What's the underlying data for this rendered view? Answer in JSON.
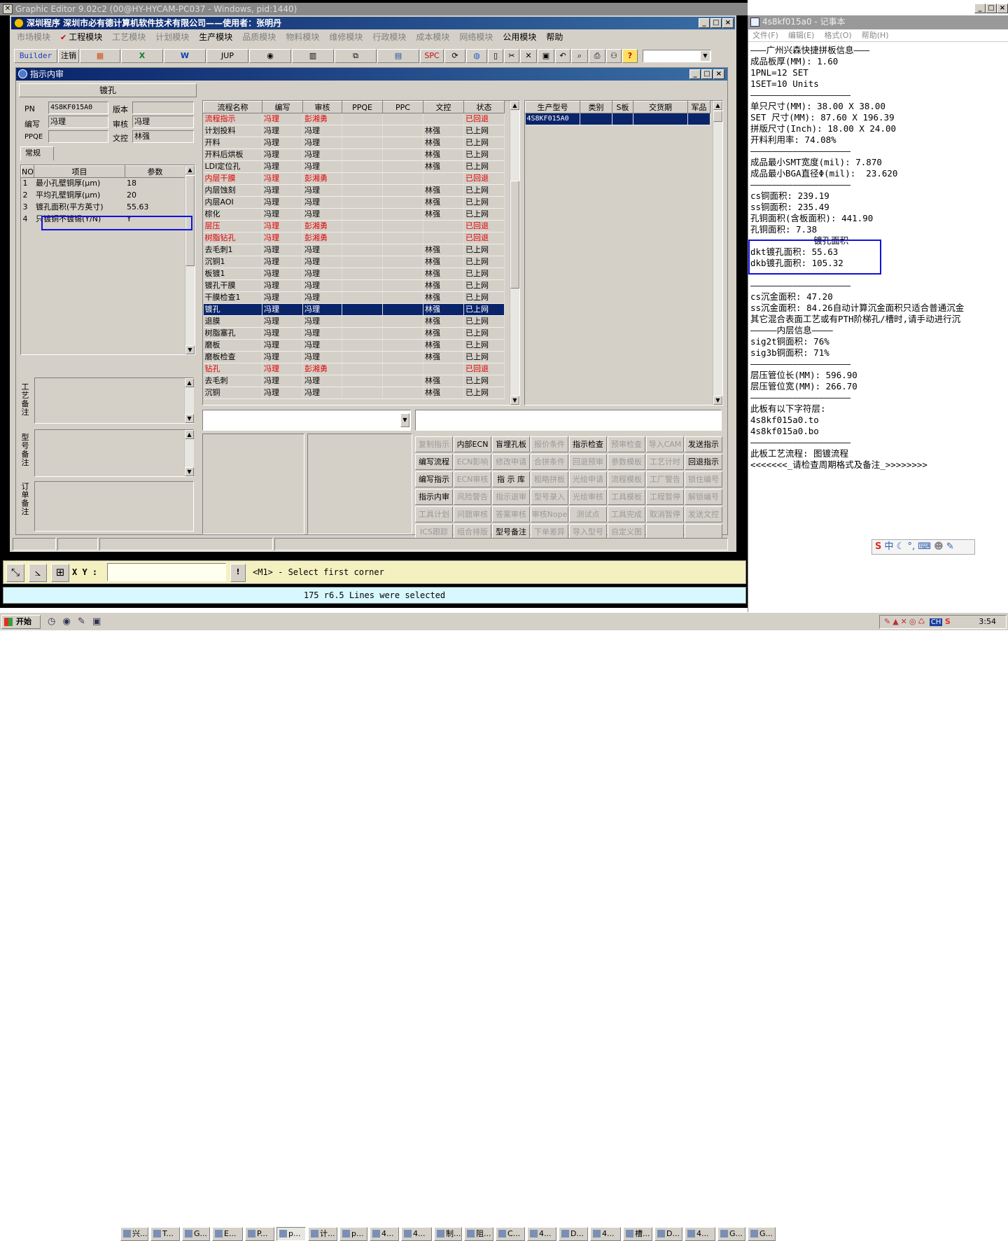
{
  "app": {
    "title": "Graphic Editor 9.02c2 (00@HY-HYCAM-PC037 - Windows, pid:1440)",
    "inner_title": "深圳程序    深圳市必有德计算机软件技术有限公司——使用者：张明丹",
    "menu": [
      {
        "label": "市场模块",
        "on": false
      },
      {
        "label": "工程模块",
        "on": true,
        "checked": true
      },
      {
        "label": "工艺模块",
        "on": false
      },
      {
        "label": "计划模块",
        "on": false
      },
      {
        "label": "生产模块",
        "on": true
      },
      {
        "label": "品质模块",
        "on": false
      },
      {
        "label": "物料模块",
        "on": false
      },
      {
        "label": "维修模块",
        "on": false
      },
      {
        "label": "行政模块",
        "on": false
      },
      {
        "label": "成本模块",
        "on": false
      },
      {
        "label": "网络模块",
        "on": false
      },
      {
        "label": "公用模块",
        "on": true
      },
      {
        "label": "帮助",
        "on": true
      }
    ],
    "toolbar": {
      "builder": "Builder",
      "logout": "注销",
      "jup": "JUP",
      "spc": "SPC"
    },
    "accent": "#0a246a"
  },
  "dialog": {
    "title": "指示内审",
    "left": {
      "section": "镀孔",
      "pn_label": "PN",
      "pn": "4S8KF015A0",
      "version_label": "版本",
      "version": "",
      "editor_label": "编写",
      "editor": "冯理",
      "auditor_label": "审核",
      "auditor": "冯理",
      "ppqe_label": "PPQE",
      "ppqe": "",
      "doc_label": "文控",
      "doc": "林强",
      "tab": "常规",
      "param_headers": [
        "NO",
        "项目",
        "参数"
      ],
      "params": [
        {
          "no": "1",
          "item": "最小孔壁铜厚(μm)",
          "value": "18"
        },
        {
          "no": "2",
          "item": "平均孔壁铜厚(μm)",
          "value": "20"
        },
        {
          "no": "3",
          "item": "镀孔面积(平方英寸)",
          "value": "55.63"
        },
        {
          "no": "4",
          "item": "只镀铜不镀锡(Y/N)",
          "value": "Y"
        }
      ],
      "labels": {
        "process_note": "工艺备注",
        "model_note": "型号备注",
        "order_note": "订单备注"
      }
    },
    "flow": {
      "headers": [
        "流程名称",
        "编写",
        "审核",
        "PPQE",
        "PPC",
        "文控",
        "状态"
      ],
      "rows": [
        {
          "name": "流程指示",
          "w": "冯理",
          "a": "彭湘勇",
          "p": "",
          "c": "",
          "d": "",
          "s": "已回退",
          "red": true
        },
        {
          "name": "计划投料",
          "w": "冯理",
          "a": "冯理",
          "p": "",
          "c": "",
          "d": "林强",
          "s": "已上网"
        },
        {
          "name": "开料",
          "w": "冯理",
          "a": "冯理",
          "p": "",
          "c": "",
          "d": "林强",
          "s": "已上网"
        },
        {
          "name": "开料后烘板",
          "w": "冯理",
          "a": "冯理",
          "p": "",
          "c": "",
          "d": "林强",
          "s": "已上网"
        },
        {
          "name": "LDI定位孔",
          "w": "冯理",
          "a": "冯理",
          "p": "",
          "c": "",
          "d": "林强",
          "s": "已上网"
        },
        {
          "name": "内层干膜",
          "w": "冯理",
          "a": "彭湘勇",
          "p": "",
          "c": "",
          "d": "",
          "s": "已回退",
          "red": true
        },
        {
          "name": "内层蚀刻",
          "w": "冯理",
          "a": "冯理",
          "p": "",
          "c": "",
          "d": "林强",
          "s": "已上网"
        },
        {
          "name": "内层AOI",
          "w": "冯理",
          "a": "冯理",
          "p": "",
          "c": "",
          "d": "林强",
          "s": "已上网"
        },
        {
          "name": "棕化",
          "w": "冯理",
          "a": "冯理",
          "p": "",
          "c": "",
          "d": "林强",
          "s": "已上网"
        },
        {
          "name": "层压",
          "w": "冯理",
          "a": "彭湘勇",
          "p": "",
          "c": "",
          "d": "",
          "s": "已回退",
          "red": true
        },
        {
          "name": "树脂钻孔",
          "w": "冯理",
          "a": "彭湘勇",
          "p": "",
          "c": "",
          "d": "",
          "s": "已回退",
          "red": true
        },
        {
          "name": "去毛刺1",
          "w": "冯理",
          "a": "冯理",
          "p": "",
          "c": "",
          "d": "林强",
          "s": "已上网"
        },
        {
          "name": "沉铜1",
          "w": "冯理",
          "a": "冯理",
          "p": "",
          "c": "",
          "d": "林强",
          "s": "已上网"
        },
        {
          "name": "板镀1",
          "w": "冯理",
          "a": "冯理",
          "p": "",
          "c": "",
          "d": "林强",
          "s": "已上网"
        },
        {
          "name": "镀孔干膜",
          "w": "冯理",
          "a": "冯理",
          "p": "",
          "c": "",
          "d": "林强",
          "s": "已上网"
        },
        {
          "name": "干膜检查1",
          "w": "冯理",
          "a": "冯理",
          "p": "",
          "c": "",
          "d": "林强",
          "s": "已上网"
        },
        {
          "name": "镀孔",
          "w": "冯理",
          "a": "冯理",
          "p": "",
          "c": "",
          "d": "林强",
          "s": "已上网",
          "sel": true
        },
        {
          "name": "退膜",
          "w": "冯理",
          "a": "冯理",
          "p": "",
          "c": "",
          "d": "林强",
          "s": "已上网"
        },
        {
          "name": "树脂塞孔",
          "w": "冯理",
          "a": "冯理",
          "p": "",
          "c": "",
          "d": "林强",
          "s": "已上网"
        },
        {
          "name": "磨板",
          "w": "冯理",
          "a": "冯理",
          "p": "",
          "c": "",
          "d": "林强",
          "s": "已上网"
        },
        {
          "name": "磨板检查",
          "w": "冯理",
          "a": "冯理",
          "p": "",
          "c": "",
          "d": "林强",
          "s": "已上网"
        },
        {
          "name": "钻孔",
          "w": "冯理",
          "a": "彭湘勇",
          "p": "",
          "c": "",
          "d": "",
          "s": "已回退",
          "red": true
        },
        {
          "name": "去毛刺",
          "w": "冯理",
          "a": "冯理",
          "p": "",
          "c": "",
          "d": "林强",
          "s": "已上网"
        },
        {
          "name": "沉铜",
          "w": "冯理",
          "a": "冯理",
          "p": "",
          "c": "",
          "d": "林强",
          "s": "已上网"
        }
      ]
    },
    "models": {
      "headers": [
        "生产型号",
        "类别",
        "S板",
        "交货期",
        "军品"
      ],
      "rows": [
        {
          "model": "4S8KF015A0",
          "type": "",
          "s": "",
          "due": "",
          "mil": ""
        }
      ]
    },
    "buttons": [
      [
        "复制指示",
        "内部ECN",
        "盲埋孔板",
        "报价条件",
        "指示检查",
        "预审检查",
        "导入CAM",
        "发送指示"
      ],
      [
        "编写流程",
        "ECN影响",
        "修改申请",
        "合拼条件",
        "回退预审",
        "参数模板",
        "工艺计时",
        "回退指示"
      ],
      [
        "编写指示",
        "ECN审核",
        "指 示 库",
        "粗略拼板",
        "光绘申请",
        "流程模板",
        "工厂警告",
        "锁住编号"
      ],
      [
        "指示内审",
        "风险警告",
        "指示退审",
        "型号录入",
        "光绘审核",
        "工具模板",
        "工程暂停",
        "解锁编号"
      ],
      [
        "工具计划",
        "问题审核",
        "答案审核",
        "审核Nope",
        "测试点",
        "工具完成",
        "取消暂停",
        "发送文控"
      ],
      [
        "ICS跟踪",
        "组合排版",
        "型号备注",
        "下单差异",
        "导入型号",
        "自定义图",
        "",
        ""
      ]
    ],
    "buttons_on": [
      [
        false,
        true,
        true,
        false,
        true,
        false,
        false,
        true
      ],
      [
        true,
        false,
        false,
        false,
        false,
        false,
        false,
        true
      ],
      [
        true,
        false,
        true,
        false,
        false,
        false,
        false,
        false
      ],
      [
        true,
        false,
        false,
        false,
        false,
        false,
        false,
        false
      ],
      [
        false,
        false,
        false,
        false,
        false,
        false,
        false,
        false
      ],
      [
        false,
        false,
        true,
        false,
        false,
        false,
        false,
        false
      ]
    ]
  },
  "cmd": {
    "xy_label": "X Y :",
    "prompt": "<M1> - Select first corner",
    "status": "175 r6.5 Lines were selected"
  },
  "notepad": {
    "title": "4s8kf015a0 - 记事本",
    "menu": [
      "文件(F)",
      "编辑(E)",
      "格式(O)",
      "帮助(H)"
    ],
    "lines": [
      "———广州兴森快捷拼板信息———",
      "成品板厚(MM): 1.60",
      "1PNL=12 SET",
      "1SET=10 Units",
      "———————————————————",
      "单只尺寸(MM): 38.00 X 38.00",
      "SET 尺寸(MM): 87.60 X 196.39",
      "拼版尺寸(Inch): 18.00 X 24.00",
      "开料利用率: 74.08%",
      "———————————————————",
      "成品最小SMT宽度(mil): 7.870",
      "成品最小BGA直径Φ(mil):  23.620",
      "———————————————————",
      "cs铜面积: 239.19",
      "ss铜面积: 235.49",
      "孔铜面积(含板面积): 441.90",
      "孔铜面积: 7.38",
      "            镀孔面积",
      "dkt镀孔面积: 55.63",
      "dkb镀孔面积: 105.32",
      "",
      "———————————————————",
      "cs沉金面积: 47.20",
      "ss沉金面积: 84.26自动计算沉金面积只适合普通沉金",
      "其它混合表面工艺或有PTH阶梯孔/槽时,请手动进行沉",
      "—————内层信息————",
      "sig2t铜面积: 76%",
      "sig3b铜面积: 71%",
      "———————————————————",
      "层压管位长(MM): 596.90",
      "层压管位宽(MM): 266.70",
      "———————————————————",
      "此板有以下字符层:",
      "4s8kf015a0.to",
      "4s8kf015a0.bo",
      "———————————————————",
      "此板工艺流程: 图镀流程",
      "<<<<<<<_请检查周期格式及备注_>>>>>>>>"
    ]
  },
  "taskbar": {
    "start": "开始",
    "clock": "3:54",
    "items": [
      "兴...",
      "T...",
      "G...",
      "E...",
      "P...",
      "p...",
      "计...",
      "p...",
      "4...",
      "4...",
      "制...",
      "阻...",
      "C...",
      "4...",
      "D...",
      "4...",
      "槽...",
      "D...",
      "4...",
      "G...",
      "G..."
    ]
  }
}
